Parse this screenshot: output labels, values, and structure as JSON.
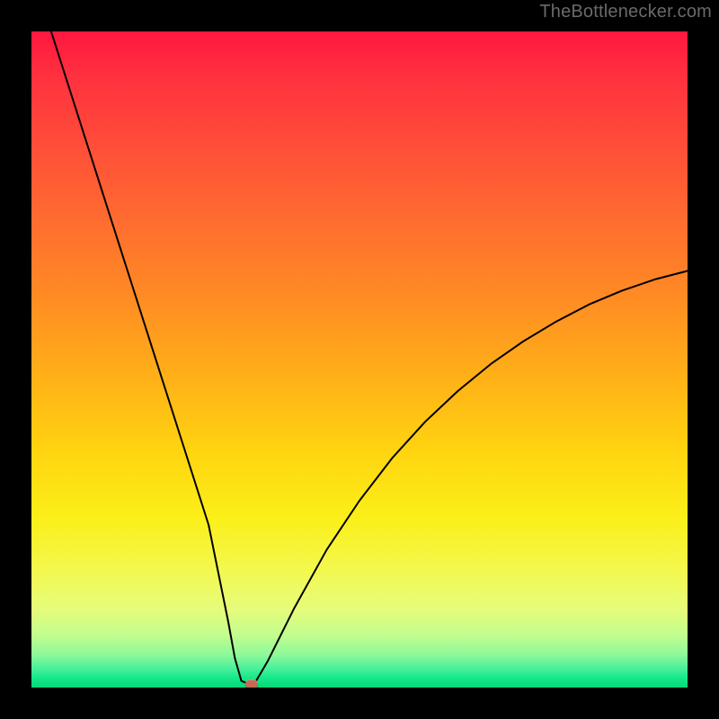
{
  "watermark": "TheBottlenecker.com",
  "chart_data": {
    "type": "line",
    "title": "",
    "xlabel": "",
    "ylabel": "",
    "xlim": [
      0,
      100
    ],
    "ylim": [
      0,
      100
    ],
    "grid": false,
    "legend": false,
    "series": [
      {
        "name": "bottleneck-curve",
        "x": [
          3,
          6,
          9,
          12,
          15,
          18,
          21,
          24,
          27,
          30,
          31,
          32,
          33,
          34,
          36,
          40,
          45,
          50,
          55,
          60,
          65,
          70,
          75,
          80,
          85,
          90,
          95,
          100
        ],
        "y": [
          100,
          90.6,
          81.2,
          71.8,
          62.4,
          53.0,
          43.6,
          34.2,
          24.8,
          10.0,
          4.5,
          1.0,
          0.6,
          0.6,
          4.0,
          12.0,
          21.0,
          28.5,
          35.0,
          40.5,
          45.2,
          49.3,
          52.8,
          55.8,
          58.4,
          60.5,
          62.2,
          63.5
        ]
      }
    ],
    "marker": {
      "x": 33.5,
      "y": 0.6
    },
    "background_gradient": {
      "stops": [
        {
          "pct": 0,
          "color": "#ff173f"
        },
        {
          "pct": 50,
          "color": "#ffae18"
        },
        {
          "pct": 80,
          "color": "#f3f84e"
        },
        {
          "pct": 100,
          "color": "#06d87a"
        }
      ]
    }
  }
}
